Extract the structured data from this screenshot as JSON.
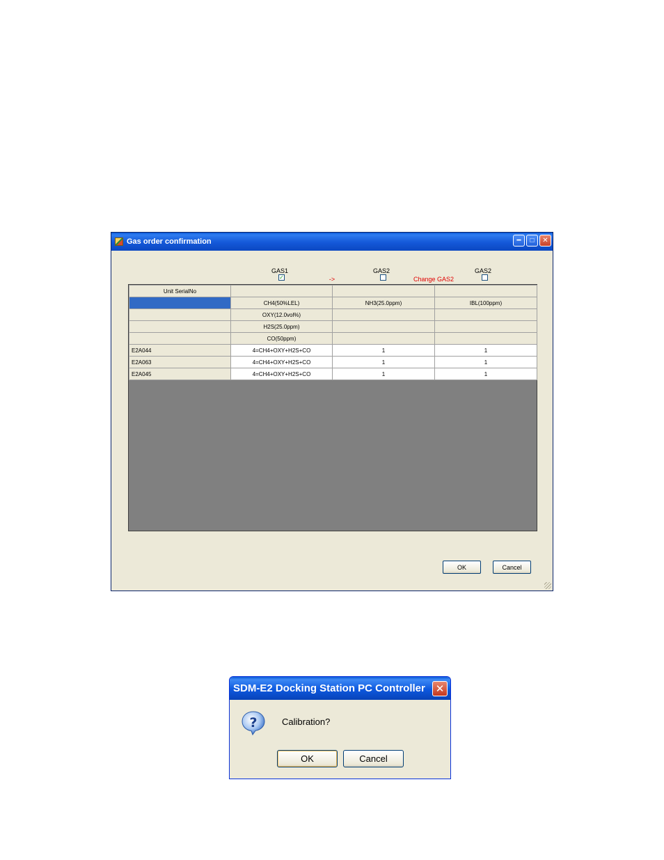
{
  "gas_dialog": {
    "title": "Gas order confirmation",
    "gas_headers": [
      {
        "label": "GAS1",
        "checked": true
      },
      {
        "label": "GAS2",
        "checked": false
      },
      {
        "label": "GAS2",
        "checked": false
      }
    ],
    "arrow_label": "->",
    "change_label": "Change GAS2",
    "table": {
      "header_unit": "Unit SerialNo",
      "gas_rows": [
        [
          "CH4(50%LEL)",
          "NH3(25.0ppm)",
          "IBL(100ppm)"
        ],
        [
          "OXY(12.0vol%)",
          "",
          ""
        ],
        [
          "H2S(25.0ppm)",
          "",
          ""
        ],
        [
          "CO(50ppm)",
          "",
          ""
        ]
      ],
      "data_rows": [
        {
          "serial": "E2A044",
          "col1": "4=CH4+OXY+H2S+CO",
          "col2": "1",
          "col3": "1"
        },
        {
          "serial": "E2A063",
          "col1": "4=CH4+OXY+H2S+CO",
          "col2": "1",
          "col3": "1"
        },
        {
          "serial": "E2A045",
          "col1": "4=CH4+OXY+H2S+CO",
          "col2": "1",
          "col3": "1"
        }
      ]
    },
    "ok_label": "OK",
    "cancel_label": "Cancel",
    "colors": {
      "selection": "#316ac5",
      "grid_background": "#808080",
      "change_text": "#e00000"
    }
  },
  "confirm_dialog": {
    "title": "SDM-E2 Docking Station PC Controller",
    "message": "Calibration?",
    "ok_label": "OK",
    "cancel_label": "Cancel",
    "icon": "question-icon"
  }
}
